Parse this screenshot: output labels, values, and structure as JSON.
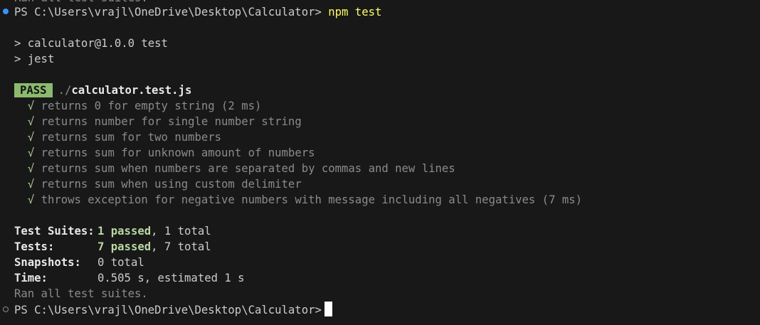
{
  "prev_output": "Ran all test suites.",
  "prompt1": {
    "prefix": "PS C:\\Users\\vrajl\\OneDrive\\Desktop\\Calculator>",
    "command": "npm test"
  },
  "npm_script": {
    "line1": "> calculator@1.0.0 test",
    "line2": "> jest"
  },
  "result": {
    "status": "PASS",
    "path_dir": "./",
    "path_file": "calculator.test.js"
  },
  "tests": [
    {
      "mark": "√",
      "text": "returns 0 for empty string (2 ms)"
    },
    {
      "mark": "√",
      "text": "returns number for single number string"
    },
    {
      "mark": "√",
      "text": "returns sum for two numbers"
    },
    {
      "mark": "√",
      "text": "returns sum for unknown amount of numbers"
    },
    {
      "mark": "√",
      "text": "returns sum when numbers are separated by commas and new lines"
    },
    {
      "mark": "√",
      "text": "returns sum when using custom delimiter"
    },
    {
      "mark": "√",
      "text": "throws exception for negative numbers with message including all negatives (7 ms)"
    }
  ],
  "summary": {
    "suites_label": "Test Suites:",
    "suites_passed": "1 passed",
    "suites_total": ", 1 total",
    "tests_label": "Tests:",
    "tests_passed": "7 passed",
    "tests_total": ", 7 total",
    "snapshots_label": "Snapshots:",
    "snapshots_value": "0 total",
    "time_label": "Time:",
    "time_value": "0.505 s, estimated 1 s",
    "ran": "Ran all test suites."
  },
  "prompt2": {
    "prefix": "PS C:\\Users\\vrajl\\OneDrive\\Desktop\\Calculator>"
  },
  "colors": {
    "background": "#181818",
    "pass_badge": "#8bba6f",
    "passed_text": "#b8d7a3",
    "command": "#ffff66",
    "decoration_success": "#3794ff"
  }
}
